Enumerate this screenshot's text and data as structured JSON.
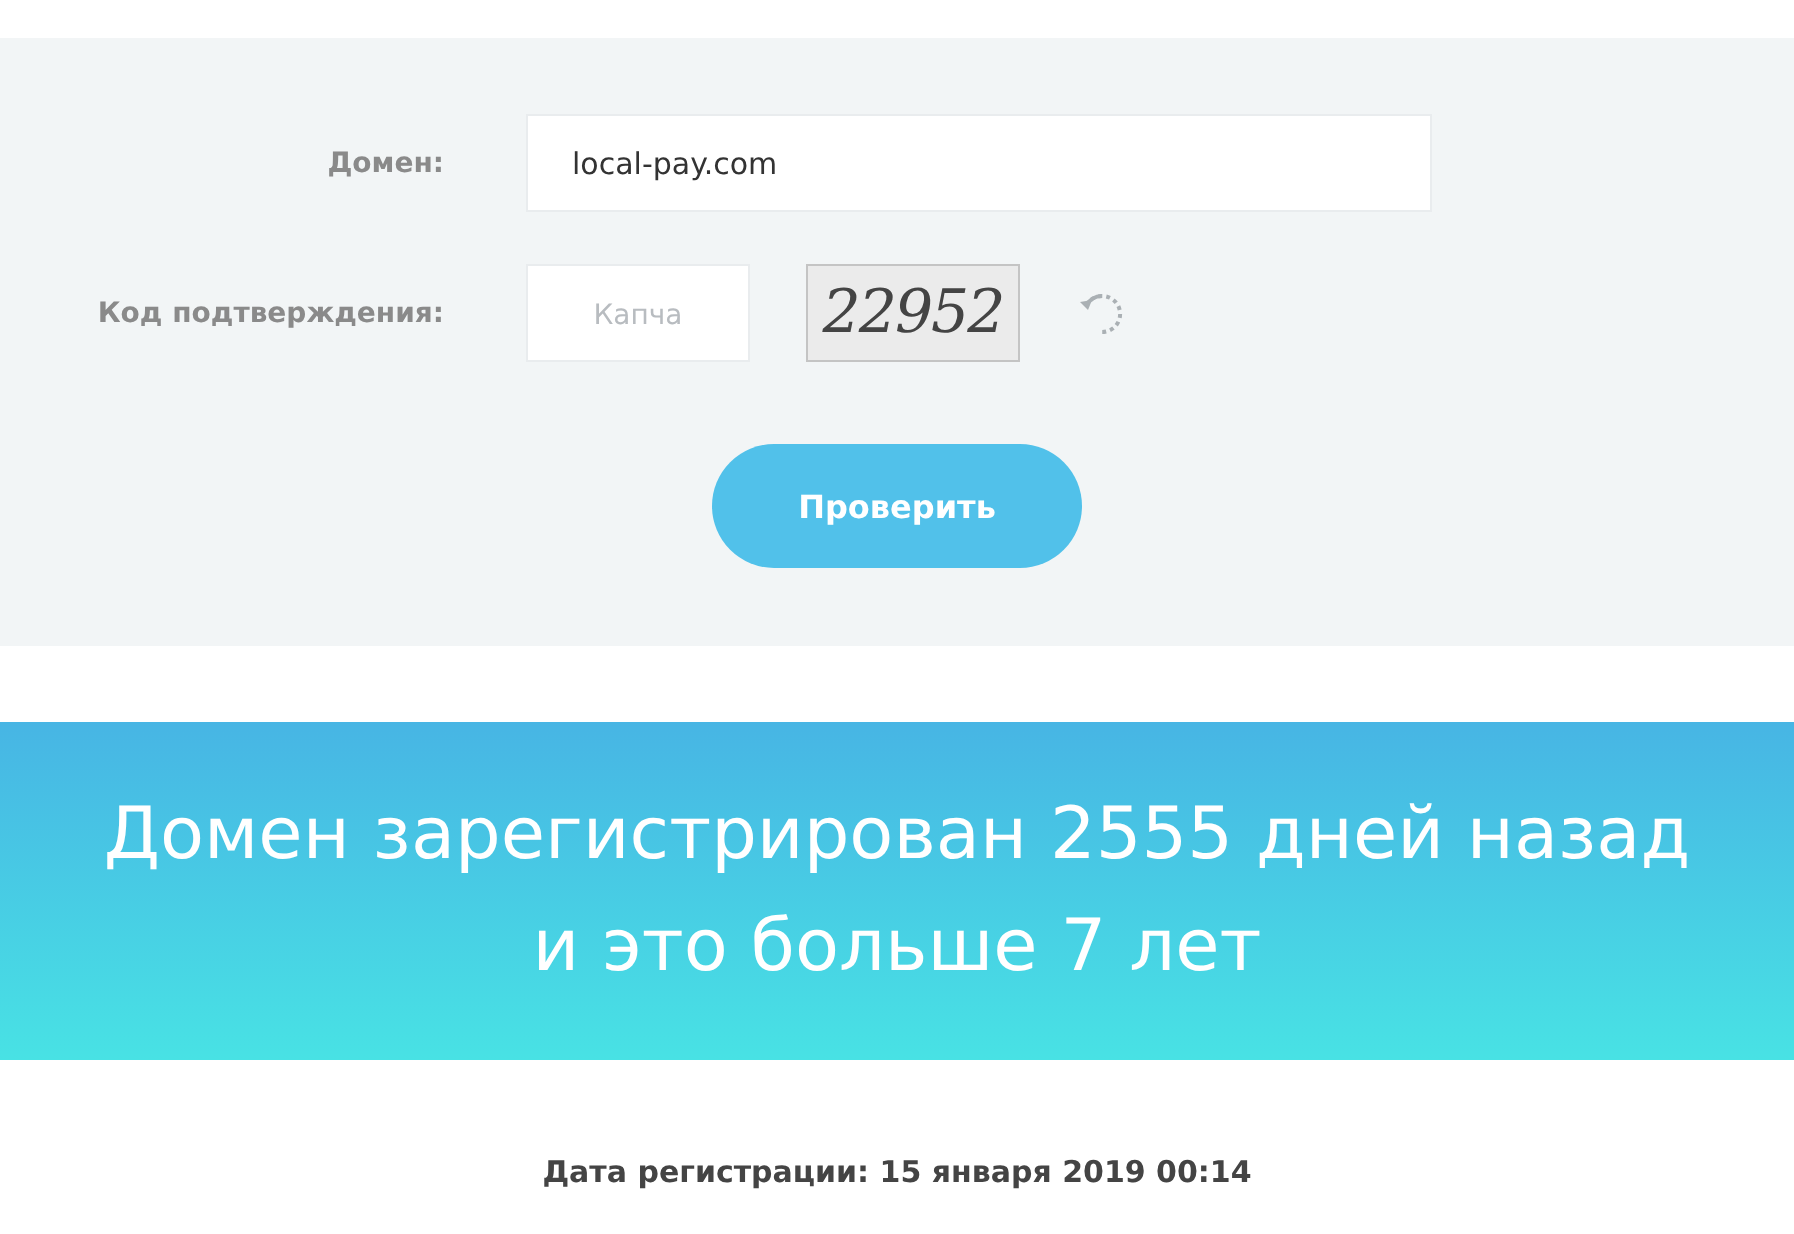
{
  "form": {
    "domain": {
      "label": "Домен:",
      "value": "local-pay.com"
    },
    "captcha": {
      "label": "Код подтверждения:",
      "placeholder": "Капча",
      "code": "22952"
    },
    "submit": "Проверить"
  },
  "result": {
    "lines": [
      "Домен зарегистрирован 2555 дней назад",
      "и это больше 7 лет"
    ],
    "registered": "Дата регистрации: 15 января 2019 00:14"
  }
}
